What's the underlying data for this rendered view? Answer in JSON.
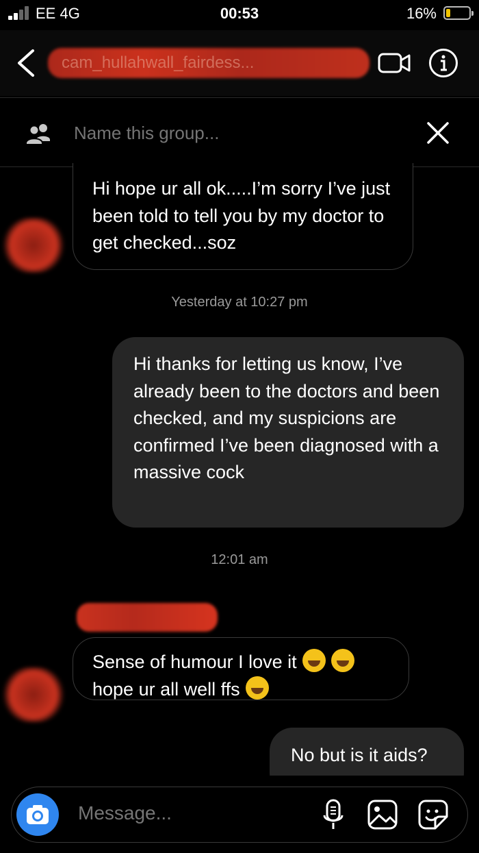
{
  "status_bar": {
    "carrier": "EE 4G",
    "time": "00:53",
    "battery": "16%"
  },
  "header": {
    "title": "cam_hullahwall_fairdess..."
  },
  "group_bar": {
    "placeholder": "Name this group..."
  },
  "messages": [
    {
      "direction": "incoming",
      "text": "Hi hope ur all ok.....I’m sorry I’ve just been told to tell you by my doctor to get checked...soz"
    },
    {
      "direction": "timestamp",
      "text": "Yesterday at 10:27 pm"
    },
    {
      "direction": "outgoing",
      "text": "Hi thanks for letting us know, I’ve already been to the doctors and been checked, and my suspicions are confirmed I’ve been diagnosed with a massive cock"
    },
    {
      "direction": "timestamp",
      "text": "12:01 am"
    },
    {
      "direction": "incoming",
      "text": "Sense of humour I love it",
      "text2": "hope ur all well ffs"
    },
    {
      "direction": "outgoing",
      "text": "No but is it aids?"
    }
  ],
  "emoji_icons": [
    "rolling-on-floor-laughing",
    "rolling-on-floor-laughing",
    "face-with-tears-of-joy"
  ],
  "composer": {
    "placeholder": "Message..."
  },
  "colors": {
    "background": "#000000",
    "outgoing_bubble": "#262626",
    "camera_button": "#2f86ef",
    "redaction": "#c9321f"
  }
}
